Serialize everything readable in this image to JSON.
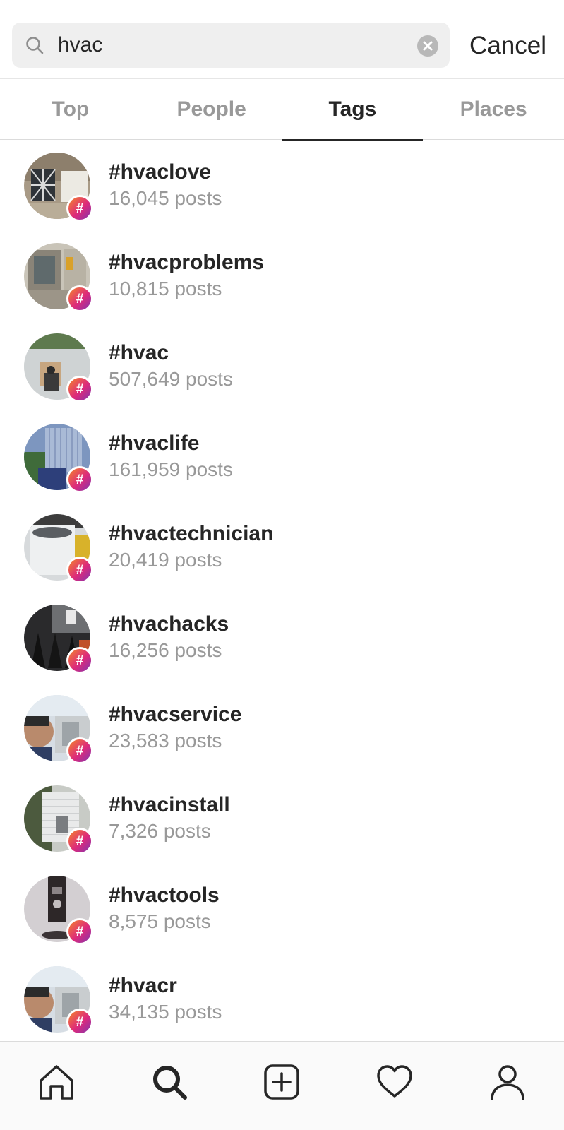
{
  "search": {
    "query": "hvac",
    "cancel_label": "Cancel"
  },
  "tabs": [
    {
      "label": "Top",
      "active": false
    },
    {
      "label": "People",
      "active": false
    },
    {
      "label": "Tags",
      "active": true
    },
    {
      "label": "Places",
      "active": false
    }
  ],
  "results": [
    {
      "name": "#hvaclove",
      "count": "16,045 posts"
    },
    {
      "name": "#hvacproblems",
      "count": "10,815 posts"
    },
    {
      "name": "#hvac",
      "count": "507,649 posts"
    },
    {
      "name": "#hvaclife",
      "count": "161,959 posts"
    },
    {
      "name": "#hvactechnician",
      "count": "20,419 posts"
    },
    {
      "name": "#hvachacks",
      "count": "16,256 posts"
    },
    {
      "name": "#hvacservice",
      "count": "23,583 posts"
    },
    {
      "name": "#hvacinstall",
      "count": "7,326 posts"
    },
    {
      "name": "#hvactools",
      "count": "8,575 posts"
    },
    {
      "name": "#hvacr",
      "count": "34,135 posts"
    }
  ],
  "badge_symbol": "#",
  "nav": [
    {
      "icon": "home-icon"
    },
    {
      "icon": "search-icon",
      "active": true
    },
    {
      "icon": "add-post-icon"
    },
    {
      "icon": "heart-icon"
    },
    {
      "icon": "profile-icon"
    }
  ],
  "colors": {
    "text_primary": "#262626",
    "text_secondary": "#999999",
    "search_bg": "#efefef",
    "badge_gradient_start": "#f58529",
    "badge_gradient_end": "#8134af"
  }
}
